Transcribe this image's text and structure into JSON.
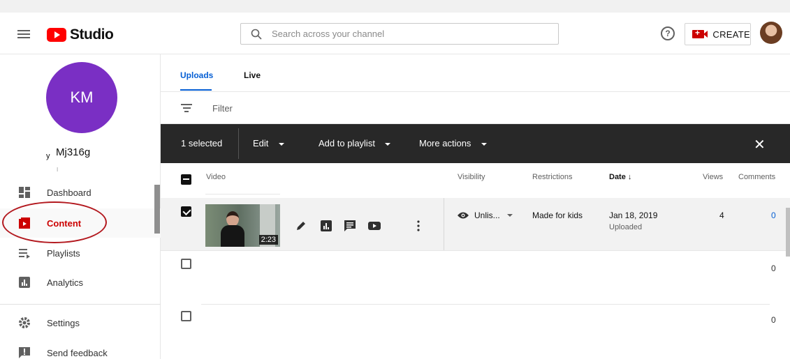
{
  "app": {
    "logo_text": "Studio",
    "search_placeholder": "Search across your channel",
    "help_label": "?",
    "create_label": "CREATE"
  },
  "channel": {
    "initials": "KM",
    "name": "Mj316g",
    "name_lead": "y",
    "name_tick": "I"
  },
  "sidebar": {
    "items": [
      {
        "label": "Dashboard",
        "icon": "dashboard-icon"
      },
      {
        "label": "Content",
        "icon": "content-icon",
        "active": true
      },
      {
        "label": "Playlists",
        "icon": "playlists-icon"
      },
      {
        "label": "Analytics",
        "icon": "analytics-icon"
      },
      {
        "label": "Settings",
        "icon": "settings-icon"
      },
      {
        "label": "Send feedback",
        "icon": "feedback-icon"
      }
    ]
  },
  "tabs": {
    "uploads": "Uploads",
    "live": "Live"
  },
  "filter": {
    "label": "Filter"
  },
  "action_bar": {
    "selected": "1 selected",
    "edit": "Edit",
    "add_to_playlist": "Add to playlist",
    "more_actions": "More actions",
    "close": "✕"
  },
  "table": {
    "headers": {
      "video": "Video",
      "visibility": "Visibility",
      "restrictions": "Restrictions",
      "date": "Date",
      "sort_arrow": "↓",
      "views": "Views",
      "comments": "Comments"
    },
    "rows": [
      {
        "duration": "2:23",
        "visibility": "Unlis...",
        "restrictions": "Made for kids",
        "date": "Jan 18, 2019",
        "date_sub": "Uploaded",
        "views": "4",
        "comments": "0",
        "selected": true
      },
      {
        "comments": "0",
        "selected": false
      },
      {
        "comments": "0",
        "selected": false
      }
    ]
  },
  "colors": {
    "brand_red": "#ff0000",
    "accent_blue": "#065fd4",
    "active_red": "#cc0000",
    "avatar_purple": "#7a2fc4",
    "action_bar_bg": "#282828",
    "annotation_red": "#b3191f"
  }
}
